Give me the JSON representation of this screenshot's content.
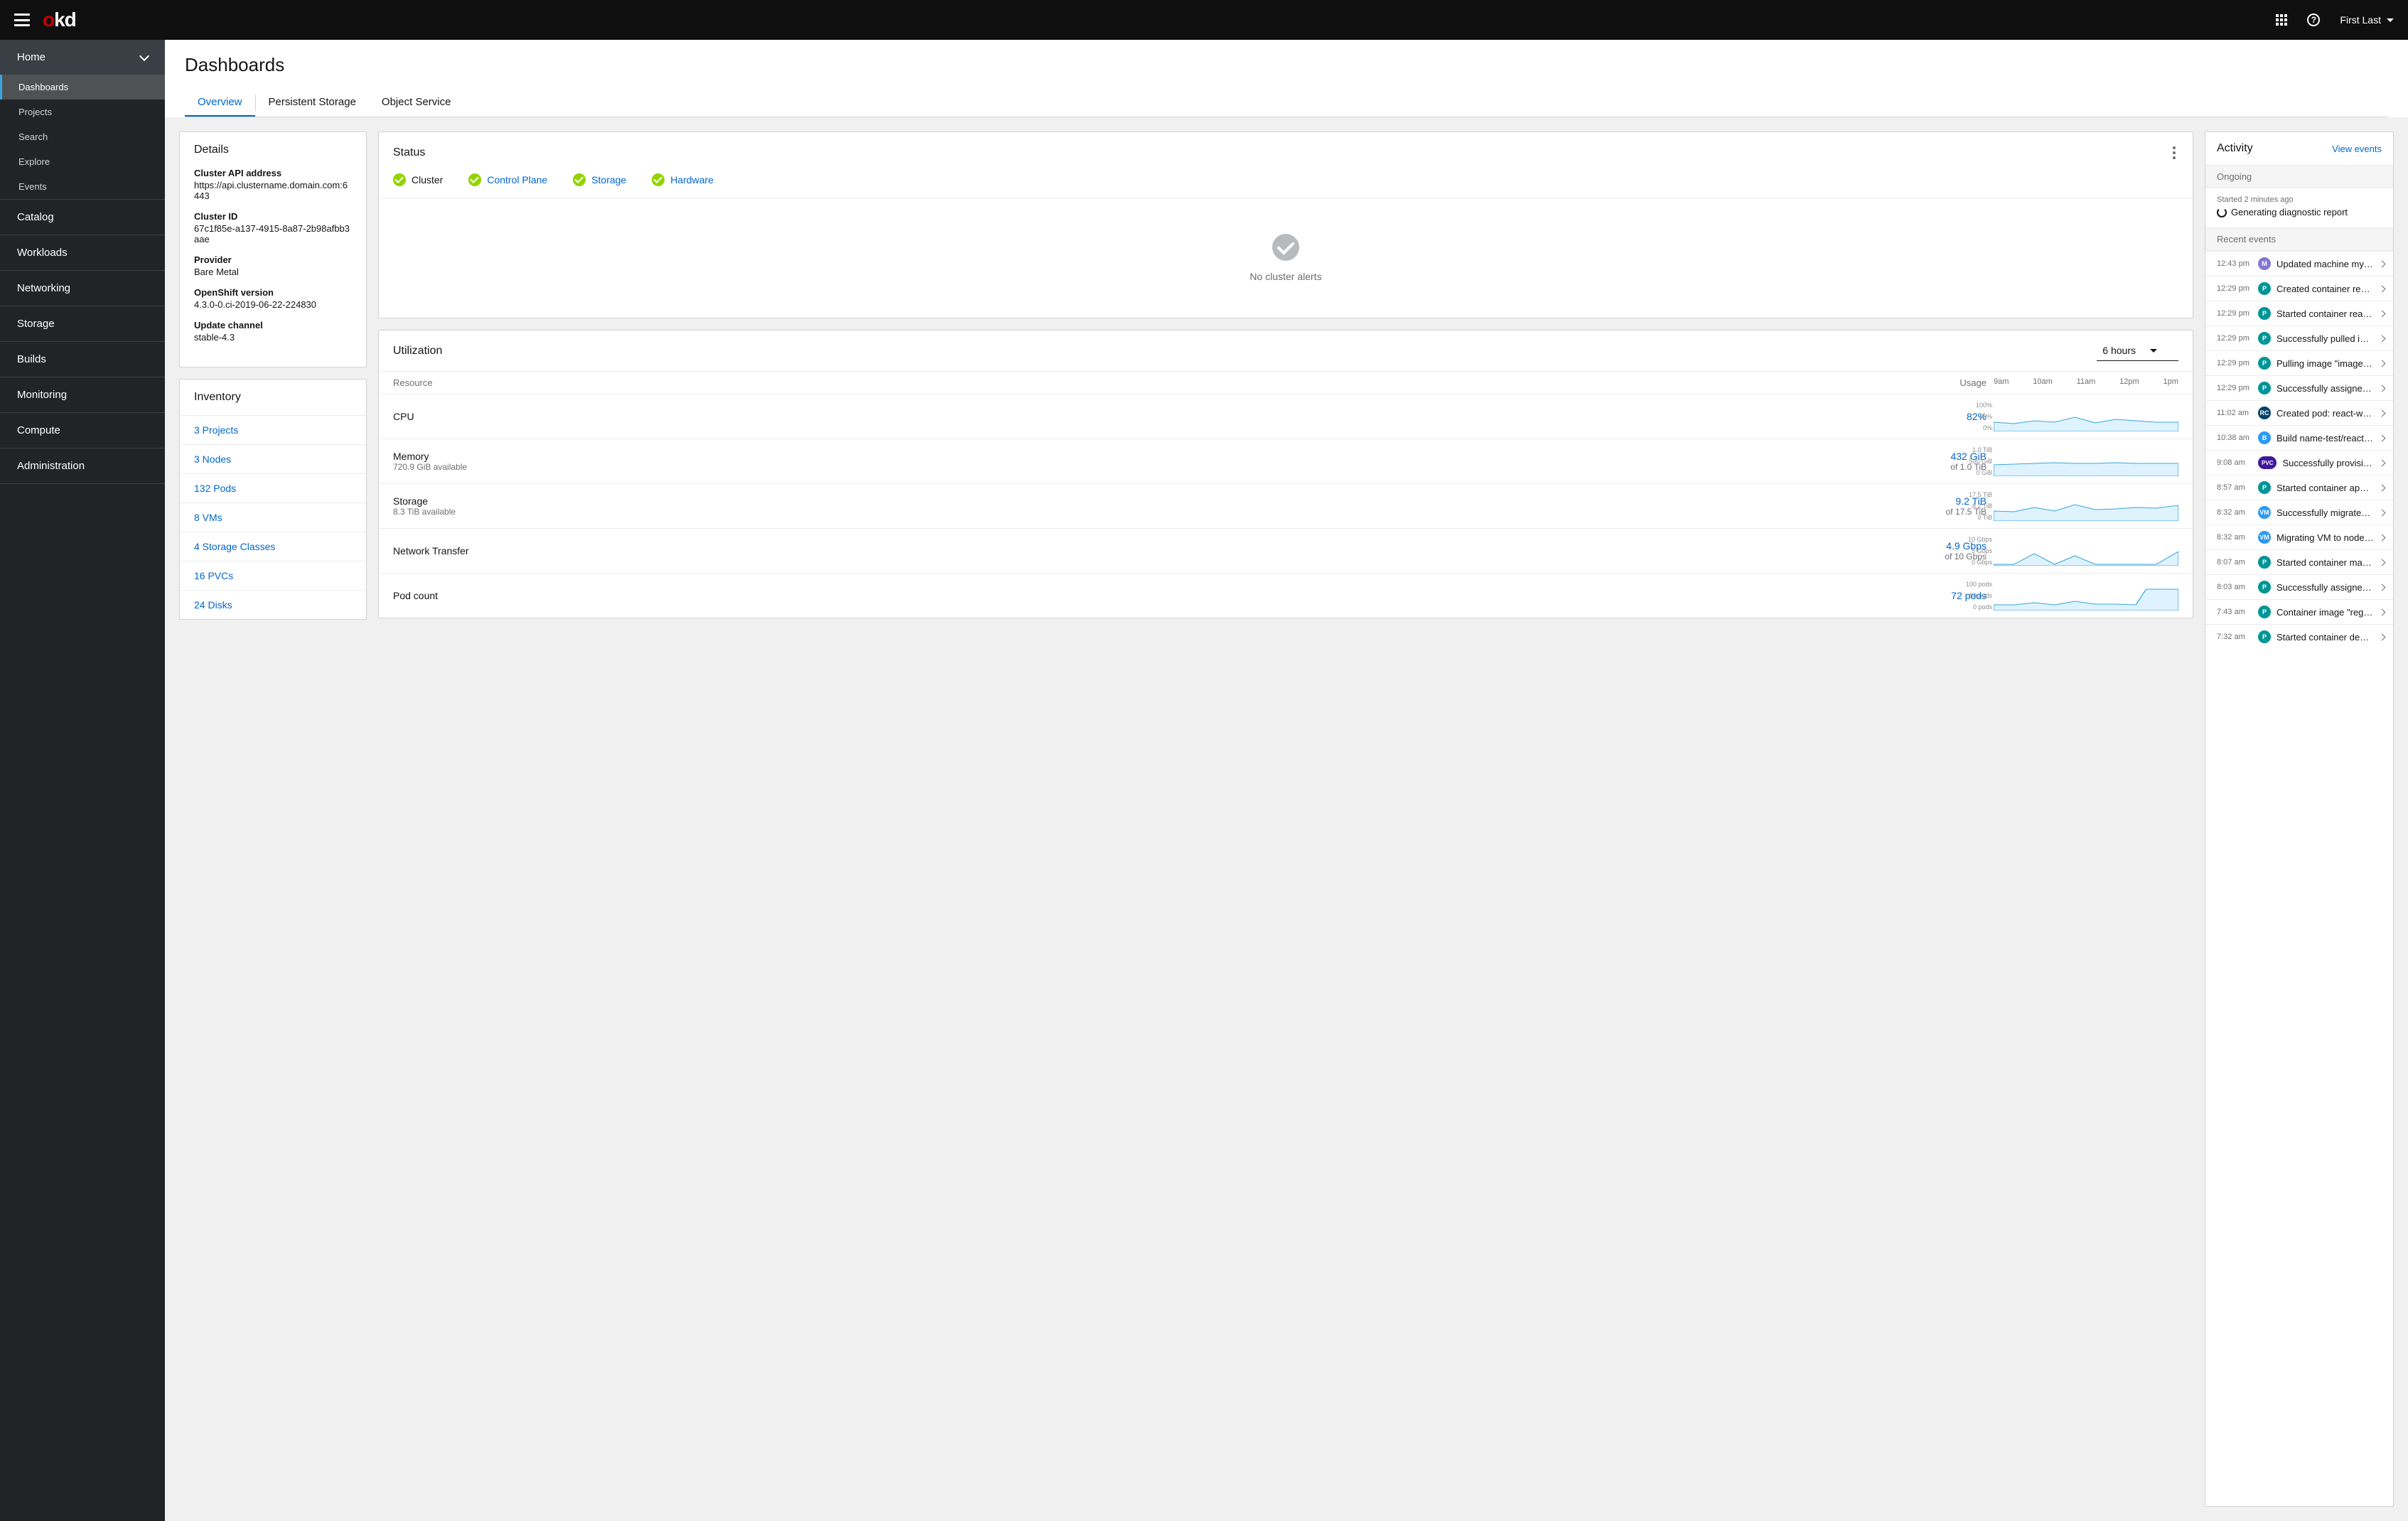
{
  "header": {
    "user": "First Last"
  },
  "sidebar": {
    "home": "Home",
    "home_items": {
      "dashboards": "Dashboards",
      "projects": "Projects",
      "search": "Search",
      "explore": "Explore",
      "events": "Events"
    },
    "catalog": "Catalog",
    "workloads": "Workloads",
    "networking": "Networking",
    "storage": "Storage",
    "builds": "Builds",
    "monitoring": "Monitoring",
    "compute": "Compute",
    "administration": "Administration"
  },
  "page": {
    "title": "Dashboards",
    "tabs": {
      "overview": "Overview",
      "persistent_storage": "Persistent Storage",
      "object_service": "Object Service"
    }
  },
  "details": {
    "title": "Details",
    "api_label": "Cluster API address",
    "api_value": "https://api.clustername.domain.com:6443",
    "id_label": "Cluster ID",
    "id_value": "67c1f85e-a137-4915-8a87-2b98afbb3aae",
    "provider_label": "Provider",
    "provider_value": "Bare Metal",
    "version_label": "OpenShift version",
    "version_value": "4.3.0-0.ci-2019-06-22-224830",
    "channel_label": "Update channel",
    "channel_value": "stable-4.3"
  },
  "inventory": {
    "title": "Inventory",
    "items": {
      "projects": "3 Projects",
      "nodes": "3 Nodes",
      "pods": "132 Pods",
      "vms": "8 VMs",
      "storage_classes": "4 Storage Classes",
      "pvcs": "16 PVCs",
      "disks": "24 Disks"
    }
  },
  "status": {
    "title": "Status",
    "cluster": "Cluster",
    "control_plane": "Control Plane",
    "storage": "Storage",
    "hardware": "Hardware",
    "no_alerts": "No cluster alerts"
  },
  "utilization": {
    "title": "Utilization",
    "range": "6 hours",
    "head_resource": "Resource",
    "head_usage": "Usage",
    "ticks": {
      "t0": "9am",
      "t1": "10am",
      "t2": "11am",
      "t3": "12pm",
      "t4": "1pm"
    },
    "cpu": {
      "label": "CPU",
      "value": "82%",
      "y0": "100%",
      "y1": "50%",
      "y2": "0%"
    },
    "memory": {
      "label": "Memory",
      "sub": "720.9 GiB available",
      "value": "432 GiB",
      "value_sub": "of 1.0 TiB",
      "y0": "1.0 TiB",
      "y1": "500 GiB",
      "y2": "0 GiB"
    },
    "storage": {
      "label": "Storage",
      "sub": "8.3 TiB available",
      "value": "9.2 TiB",
      "value_sub": "of 17.5 TiB",
      "y0": "17.5 TiB",
      "y1": "8.2 TiB",
      "y2": "0 TiB"
    },
    "network": {
      "label": "Network Transfer",
      "value": "4.9 Gbps",
      "value_sub": "of 10 Gbps",
      "y0": "10 Gbps",
      "y1": "5 Gbps",
      "y2": "0 Gbps"
    },
    "pods": {
      "label": "Pod count",
      "value": "72 pods",
      "y0": "100 pods",
      "y1": "50 pods",
      "y2": "0 pods"
    }
  },
  "activity": {
    "title": "Activity",
    "view_events": "View events",
    "ongoing_label": "Ongoing",
    "ongoing_time": "Started 2 minutes ago",
    "ongoing_text": "Generating diagnostic report",
    "recent_label": "Recent events",
    "events": [
      {
        "time": "12:43 pm",
        "badge": "M",
        "color": "#8476d1",
        "text": "Updated machine mynam..."
      },
      {
        "time": "12:29 pm",
        "badge": "P",
        "color": "#009596",
        "text": "Created container reacta..."
      },
      {
        "time": "12:29 pm",
        "badge": "P",
        "color": "#009596",
        "text": "Started container reacta..."
      },
      {
        "time": "12:29 pm",
        "badge": "P",
        "color": "#009596",
        "text": "Successfully pulled imag..."
      },
      {
        "time": "12:29 pm",
        "badge": "P",
        "color": "#009596",
        "text": "Pulling image \"image-re..."
      },
      {
        "time": "12:29 pm",
        "badge": "P",
        "color": "#009596",
        "text": "Successfully assigned ap..."
      },
      {
        "time": "11:02 am",
        "badge": "RC",
        "color": "#004368",
        "text": "Created pod: react-web-..."
      },
      {
        "time": "10:38 am",
        "badge": "B",
        "color": "#2b9af3",
        "text": "Build name-test/react-we..."
      },
      {
        "time": "9:08 am",
        "badge": "PVC",
        "color": "#40199a",
        "text": "Successfully provision...",
        "pill": true
      },
      {
        "time": "8:57 am",
        "badge": "P",
        "color": "#009596",
        "text": "Started container appde..."
      },
      {
        "time": "8:32 am",
        "badge": "VM",
        "color": "#2b9af3",
        "text": "Successfully migrated V..."
      },
      {
        "time": "8:32 am",
        "badge": "VM",
        "color": "#2b9af3",
        "text": "Migrating VM to node ip..."
      },
      {
        "time": "8:07 am",
        "badge": "P",
        "color": "#009596",
        "text": "Started container manag..."
      },
      {
        "time": "8:03 am",
        "badge": "P",
        "color": "#009596",
        "text": "Successfully assigned m..."
      },
      {
        "time": "7:43 am",
        "badge": "P",
        "color": "#009596",
        "text": "Container image \"registr..."
      },
      {
        "time": "7:32 am",
        "badge": "P",
        "color": "#009596",
        "text": "Started container deploy..."
      }
    ]
  },
  "chart_data": [
    {
      "type": "area",
      "name": "CPU",
      "x": [
        "9am",
        "10am",
        "11am",
        "12pm",
        "1pm"
      ],
      "values_pct": [
        30,
        25,
        35,
        30,
        48,
        28,
        40,
        35,
        32,
        30
      ],
      "ylim": [
        0,
        100
      ],
      "ylabel": "%"
    },
    {
      "type": "area",
      "name": "Memory",
      "x": [
        "9am",
        "10am",
        "11am",
        "12pm",
        "1pm"
      ],
      "values_gib": [
        380,
        400,
        420,
        440,
        420,
        430,
        440,
        432,
        432,
        432
      ],
      "ylim_gib": [
        0,
        1024
      ],
      "ylabel": "GiB"
    },
    {
      "type": "area",
      "name": "Storage",
      "x": [
        "9am",
        "10am",
        "11am",
        "12pm",
        "1pm"
      ],
      "values_tib": [
        6.0,
        5.5,
        8.0,
        6.0,
        9.5,
        6.5,
        7.0,
        8.0,
        7.5,
        9.2
      ],
      "ylim_tib": [
        0,
        17.5
      ],
      "ylabel": "TiB"
    },
    {
      "type": "area",
      "name": "Network Transfer",
      "x": [
        "9am",
        "10am",
        "11am",
        "12pm",
        "1pm"
      ],
      "values_gbps": [
        0.5,
        0.5,
        4.0,
        0.5,
        3.2,
        0.5,
        0.5,
        0.5,
        0.5,
        4.9
      ],
      "ylim_gbps": [
        0,
        10
      ],
      "ylabel": "Gbps"
    },
    {
      "type": "area",
      "name": "Pod count",
      "x": [
        "9am",
        "10am",
        "11am",
        "12pm",
        "1pm"
      ],
      "values": [
        20,
        18,
        25,
        20,
        30,
        22,
        21,
        20,
        72,
        72
      ],
      "ylim": [
        0,
        100
      ],
      "ylabel": "pods"
    }
  ]
}
